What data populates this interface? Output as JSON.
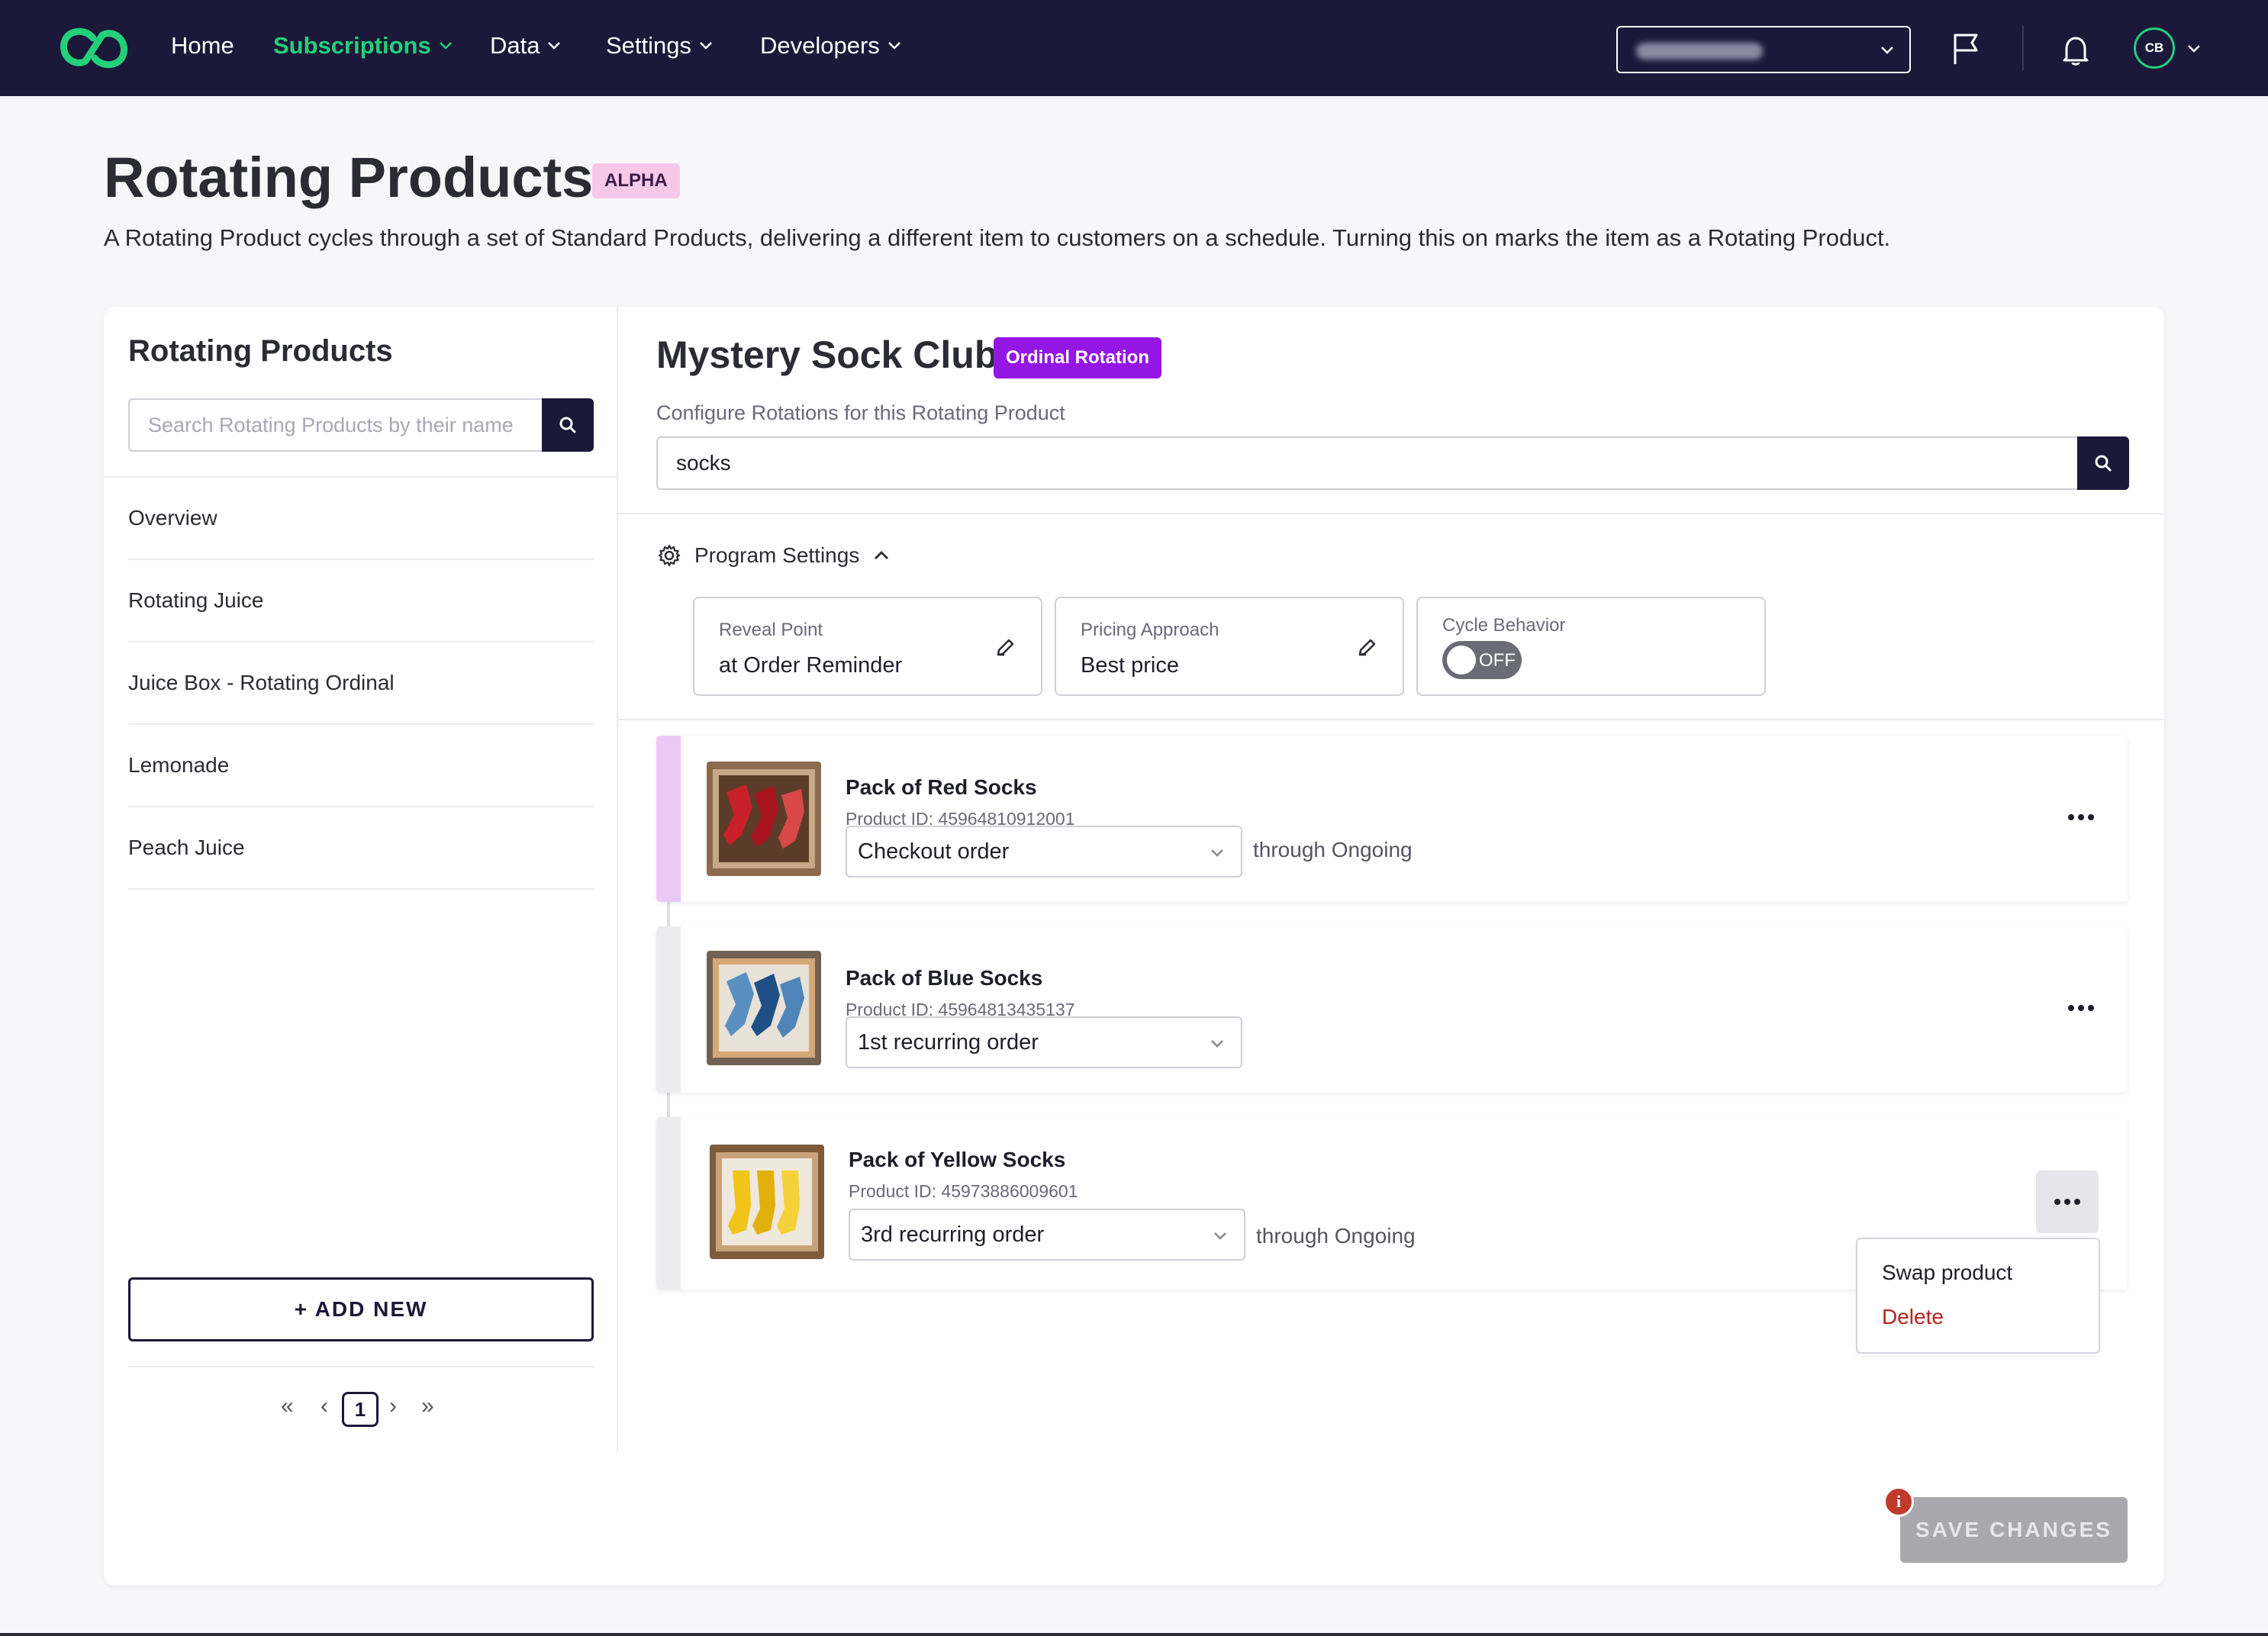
{
  "nav": {
    "items": [
      {
        "label": "Home"
      },
      {
        "label": "Subscriptions"
      },
      {
        "label": "Data"
      },
      {
        "label": "Settings"
      },
      {
        "label": "Developers"
      }
    ],
    "active_item": "Subscriptions",
    "avatar_initials": "CB",
    "icons": [
      "logo-icon",
      "flag-icon",
      "bell-icon"
    ],
    "accent_color": "#22d07a",
    "bg_color": "#1b1839"
  },
  "page": {
    "title": "Rotating Products",
    "badge": "ALPHA",
    "description": "A Rotating Product cycles through a set of Standard Products, delivering a different item to customers on a schedule. Turning this on marks the item as a Rotating Product."
  },
  "sidebar": {
    "title": "Rotating Products",
    "search_placeholder": "Search Rotating Products by their name",
    "items": [
      {
        "label": "Overview"
      },
      {
        "label": "Rotating Juice"
      },
      {
        "label": "Juice Box - Rotating Ordinal"
      },
      {
        "label": "Lemonade"
      },
      {
        "label": "Peach Juice"
      }
    ],
    "add_new_label": "+ ADD NEW",
    "pagination": {
      "first": "«",
      "prev": "‹",
      "current": "1",
      "next": "›",
      "last": "»"
    }
  },
  "main": {
    "title": "Mystery Sock Club",
    "badge": "Ordinal Rotation",
    "badge_color": "#9416e5",
    "config_label": "Configure Rotations for this Rotating Product",
    "search_value": "socks",
    "program_settings_label": "Program Settings",
    "settings": {
      "reveal_point": {
        "label": "Reveal Point",
        "value": "at Order Reminder"
      },
      "pricing_approach": {
        "label": "Pricing Approach",
        "value": "Best price"
      },
      "cycle_behavior": {
        "label": "Cycle Behavior",
        "toggle_text": "OFF",
        "enabled": false
      }
    },
    "rotations": [
      {
        "name": "Pack of Red Socks",
        "product_id": "Product ID: 45964810912001",
        "order": "Checkout order",
        "through": "through Ongoing",
        "color": "#c8202a"
      },
      {
        "name": "Pack of Blue Socks",
        "product_id": "Product ID: 45964813435137",
        "order": "1st recurring order",
        "through": "",
        "color": "#4f85b8"
      },
      {
        "name": "Pack of Yellow Socks",
        "product_id": "Product ID: 45973886009601",
        "order": "3rd recurring order",
        "through": "through Ongoing",
        "color": "#f0c419"
      }
    ],
    "menu": {
      "swap_label": "Swap product",
      "delete_label": "Delete",
      "delete_color": "#b3261e"
    },
    "save_label": "SAVE CHANGES",
    "info_icon_text": "i"
  }
}
